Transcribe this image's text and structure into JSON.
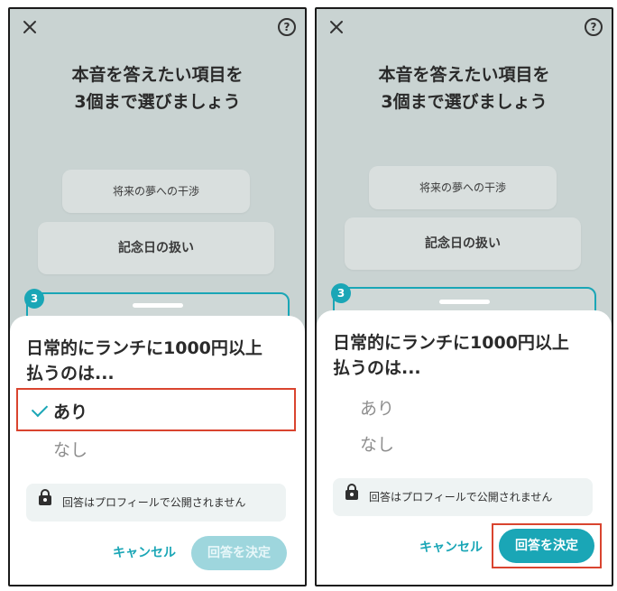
{
  "screens": [
    {
      "title": "本音を答えたい項目を\n3個まで選びましょう",
      "cards": {
        "first": "将来の夢への干渉",
        "second": "記念日の扱い",
        "third_number": "3"
      },
      "question": "日常的にランチに1000円以上\n払うのは...",
      "options": [
        "あり",
        "なし"
      ],
      "selected_option": "あり",
      "notice": "回答はプロフィールで公開されません",
      "cancel_label": "キャンセル",
      "submit_label": "回答を決定",
      "submit_state": "disabled"
    },
    {
      "title": "本音を答えたい項目を\n3個まで選びましょう",
      "cards": {
        "first": "将来の夢への干渉",
        "second": "記念日の扱い",
        "third_number": "3"
      },
      "question": "日常的にランチに1000円以上\n払うのは...",
      "options": [
        "あり",
        "なし"
      ],
      "selected_option": null,
      "notice": "回答はプロフィールで公開されません",
      "cancel_label": "キャンセル",
      "submit_label": "回答を決定",
      "submit_state": "enabled"
    }
  ],
  "icons": {
    "close": "close-icon",
    "help": "help-icon",
    "check": "check-icon",
    "lock": "lock-icon"
  },
  "colors": {
    "accent": "#1aa6b6",
    "highlight": "#d9442f",
    "overlay": "#c9d3d2"
  }
}
